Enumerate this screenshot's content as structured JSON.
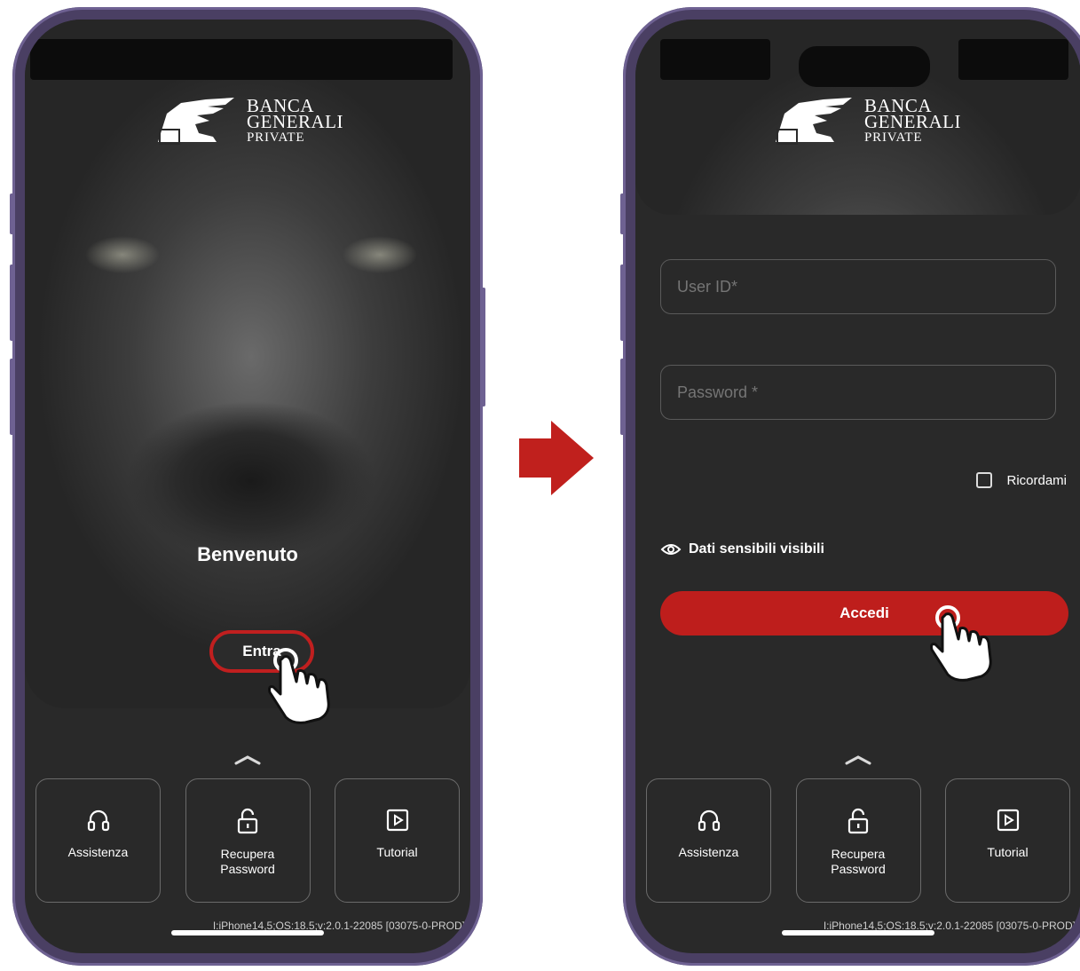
{
  "brand": {
    "line1": "BANCA",
    "line2": "GENERALI",
    "line3": "PRIVATE"
  },
  "welcome_screen": {
    "greeting": "Benvenuto",
    "enter_label": "Entra"
  },
  "login_screen": {
    "user_placeholder": "User ID*",
    "password_placeholder": "Password *",
    "remember_label": "Ricordami",
    "sensitive_label": "Dati sensibili visibili",
    "login_label": "Accedi"
  },
  "tiles": [
    {
      "label": "Assistenza",
      "icon": "headphones-icon"
    },
    {
      "label": "Recupera Password",
      "icon": "unlock-icon"
    },
    {
      "label": "Tutorial",
      "icon": "play-icon"
    }
  ],
  "footer": {
    "build_info": "I:iPhone14,5;OS:18.5;v:2.0.1-22085 [03075-0-PROD]"
  },
  "colors": {
    "accent": "#be1e1c",
    "background": "#292929",
    "frame": "#4a3f63"
  }
}
